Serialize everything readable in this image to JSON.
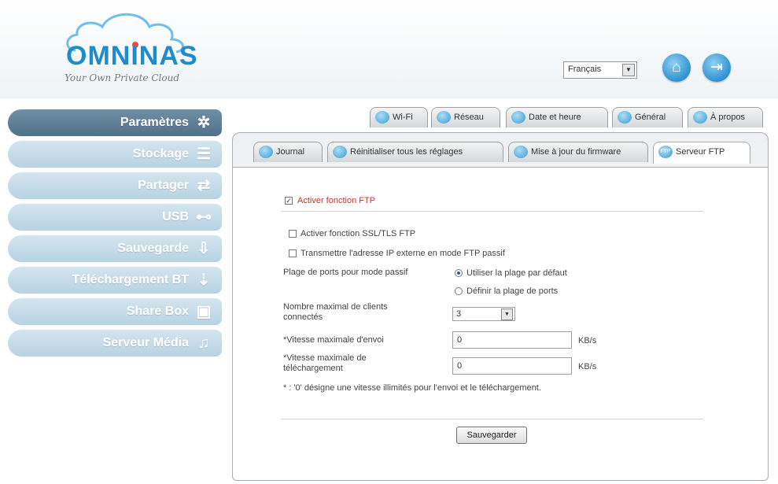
{
  "header": {
    "brand": "OMNINAS",
    "tagline": "Your Own Private Cloud",
    "language": "Français",
    "home_icon": "home-icon",
    "logout_icon": "logout-icon"
  },
  "sidebar": {
    "items": [
      {
        "label": "Paramètres",
        "icon": "settings-icon",
        "glyph": "✲"
      },
      {
        "label": "Stockage",
        "icon": "storage-icon",
        "glyph": "☰"
      },
      {
        "label": "Partager",
        "icon": "share-icon",
        "glyph": "⇄"
      },
      {
        "label": "USB",
        "icon": "usb-icon",
        "glyph": "⊷"
      },
      {
        "label": "Sauvegarde",
        "icon": "backup-icon",
        "glyph": "⇩"
      },
      {
        "label": "Téléchargement BT",
        "icon": "bt-download-icon",
        "glyph": "⇣"
      },
      {
        "label": "Share Box",
        "icon": "share-box-icon",
        "glyph": "▣"
      },
      {
        "label": "Serveur Média",
        "icon": "media-server-icon",
        "glyph": "♫"
      }
    ]
  },
  "tabs_top": [
    {
      "label": "Wi-Fi"
    },
    {
      "label": "Réseau"
    },
    {
      "label": "Date et heure"
    },
    {
      "label": "Général"
    },
    {
      "label": "À propos"
    }
  ],
  "tabs_sub": [
    {
      "label": "Journal"
    },
    {
      "label": "Réinitialiser tous les réglages"
    },
    {
      "label": "Mise à jour du firmware"
    },
    {
      "label": "Serveur FTP"
    }
  ],
  "ftp_icon_text": "FTP",
  "form": {
    "enable_ftp": "Activer fonction FTP",
    "enable_ssl": "Activer fonction SSL/TLS FTP",
    "external_ip": "Transmettre l'adresse IP externe en mode FTP passif",
    "passive_range_label": "Plage de ports pour mode passif",
    "radio_default": "Utiliser la plage par défaut",
    "radio_define": "Définir la plage de ports",
    "max_clients_label": "Nombre maximal de clients connectés",
    "max_clients_value": "3",
    "upload_label": "*Vitesse maximale d'envoi",
    "upload_value": "0",
    "upload_unit": "KB/s",
    "download_label": "*Vitesse maximale de téléchargement",
    "download_value": "0",
    "download_unit": "KB/s",
    "note": "* : '0' désigne une vitesse illimités pour l'envoi et le téléchargement.",
    "save_button": "Sauvegarder"
  },
  "colors": {
    "brand_blue": "#1e8ccc",
    "sidebar_active": "#5d7e95",
    "sidebar_idle": "#c4dbe8",
    "enable_ftp_text": "#c0392b"
  }
}
